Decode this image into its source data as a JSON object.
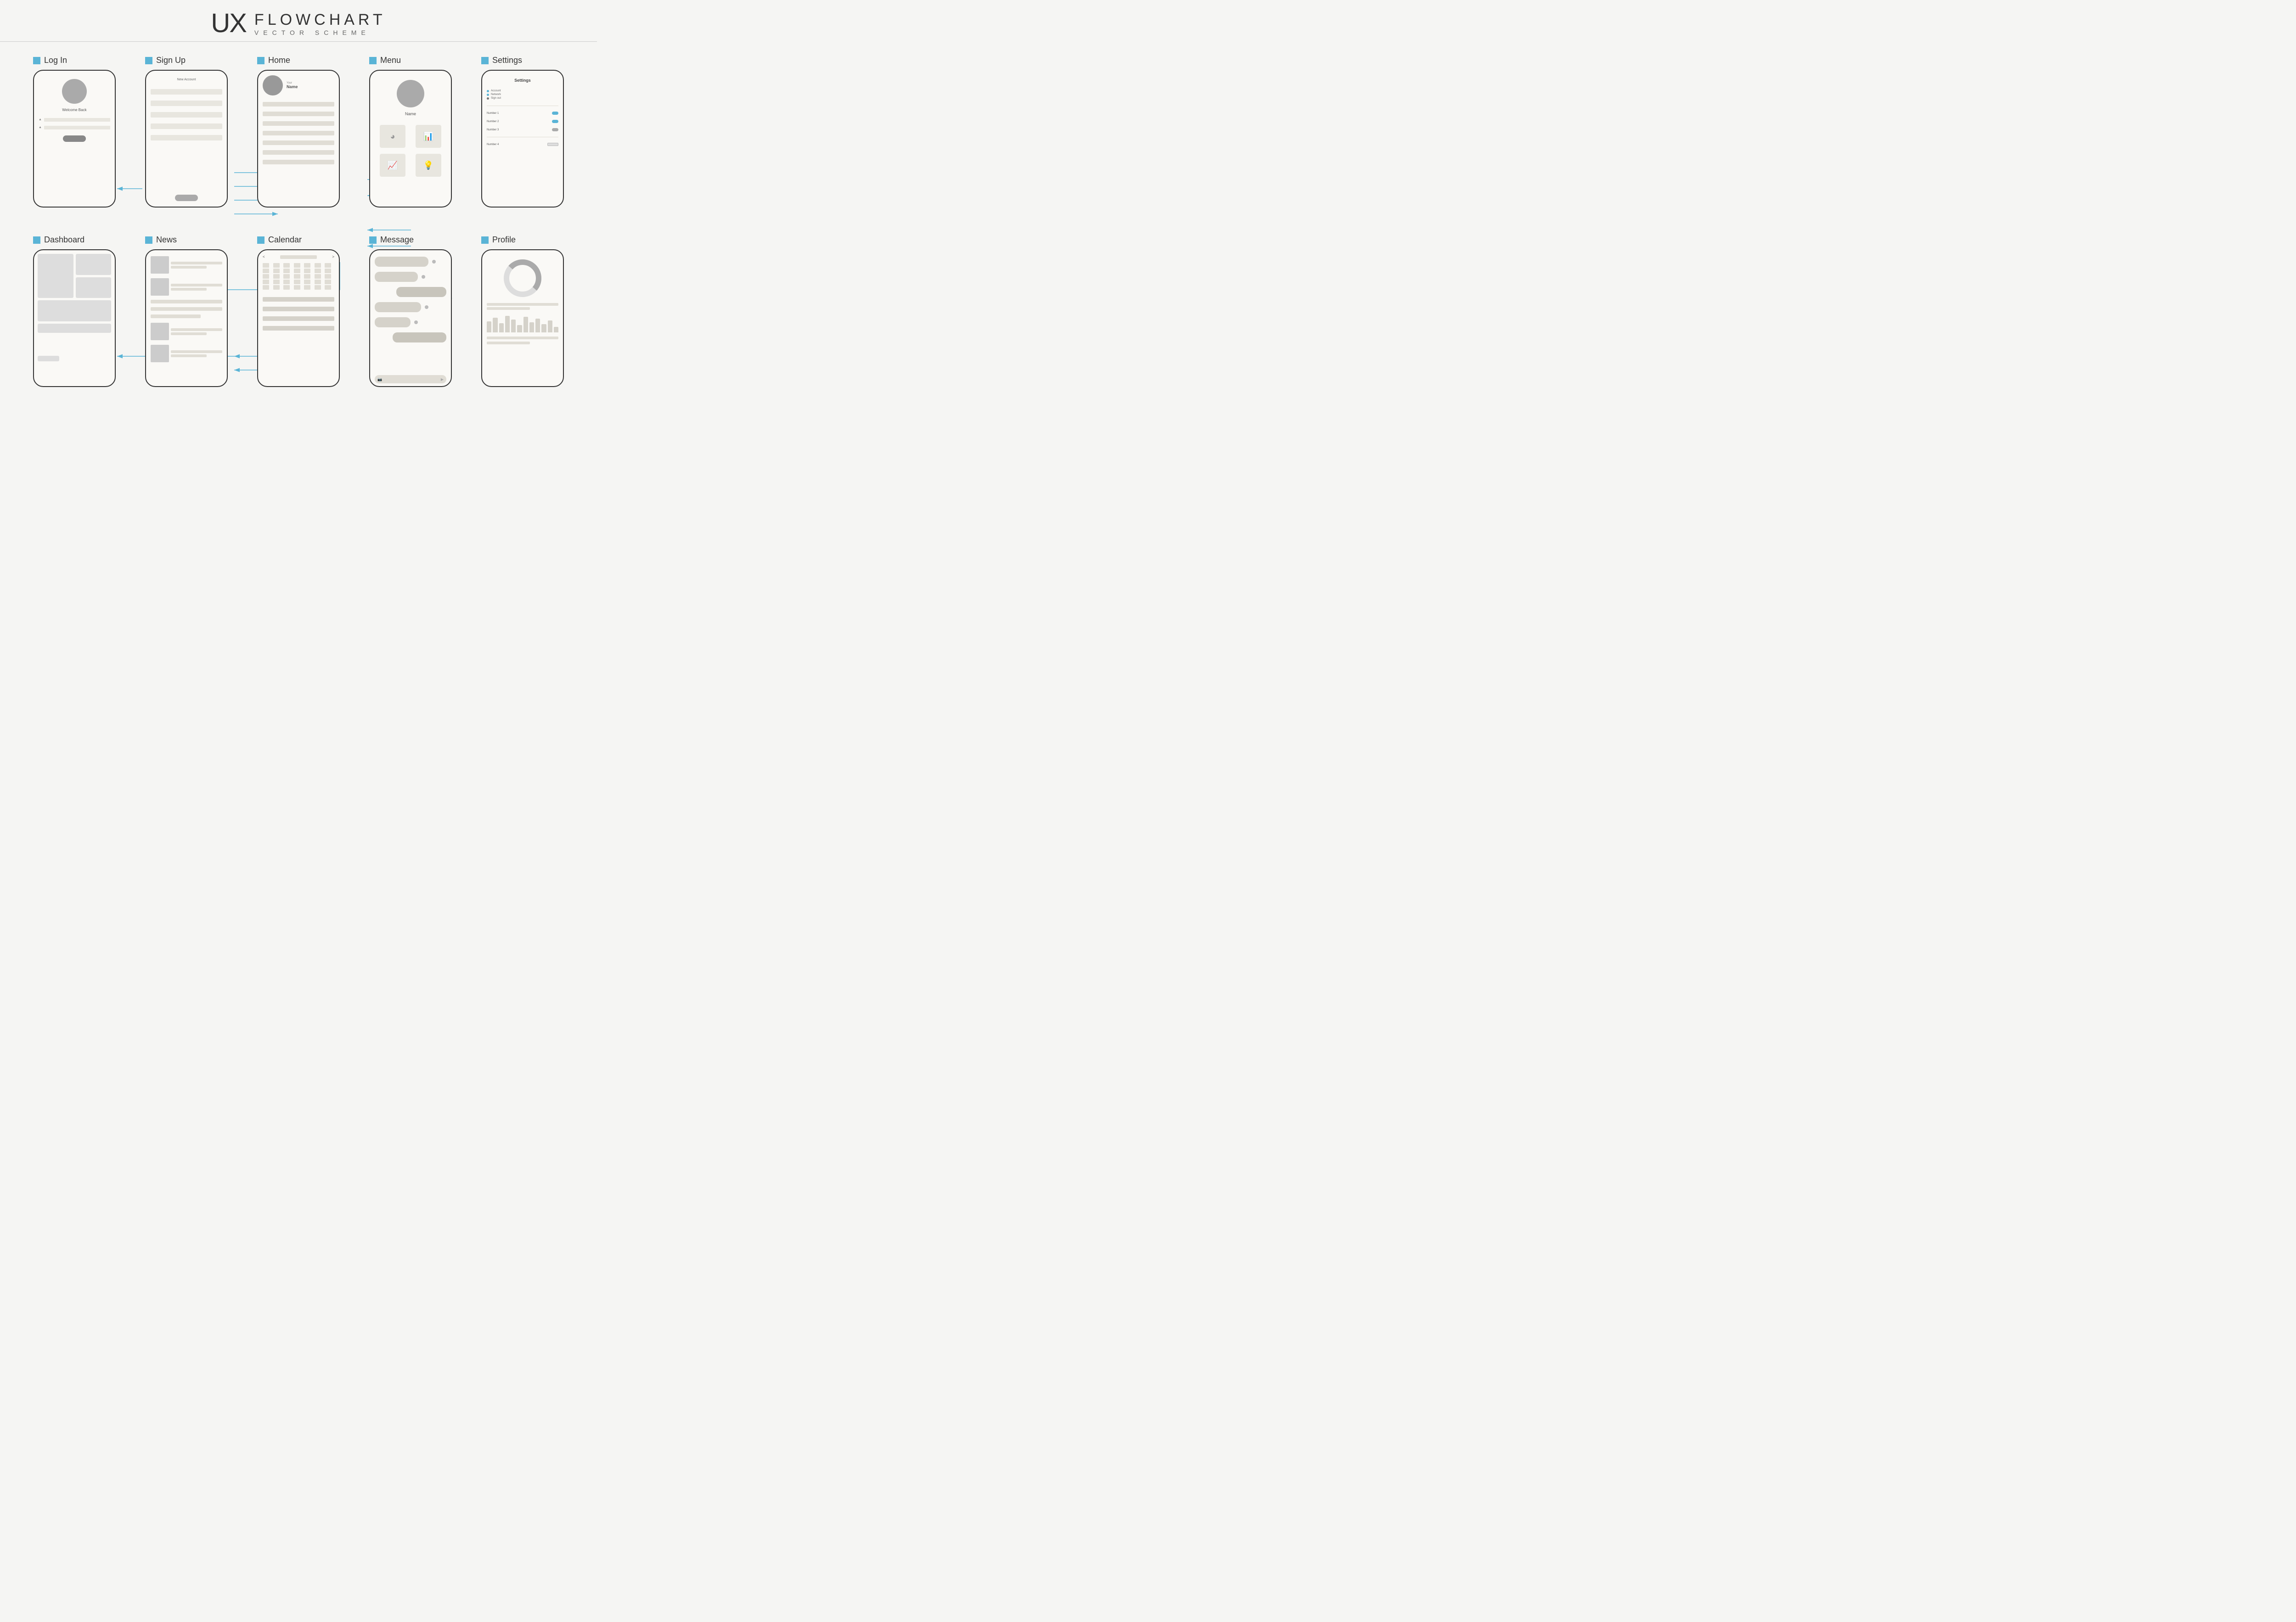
{
  "header": {
    "ux": "UX",
    "flowchart": "FLOWCHART",
    "vector": "VECTOR SCHEME"
  },
  "row1": {
    "sections": [
      {
        "label": "Log In",
        "content": "login",
        "avatar_color": "#aaa",
        "welcome": "Welcome Back"
      },
      {
        "label": "Sign Up",
        "content": "signup",
        "title": "New Account"
      },
      {
        "label": "Home",
        "content": "home",
        "name_small": "Your",
        "name_big": "Name"
      },
      {
        "label": "Menu",
        "content": "menu",
        "name": "Name"
      },
      {
        "label": "Settings",
        "content": "settings",
        "title": "Settings",
        "items": [
          "Account",
          "Network",
          "Sign out"
        ],
        "rows": [
          "Number 1",
          "Number 2",
          "Number 3",
          "Number 4"
        ]
      }
    ]
  },
  "row2": {
    "sections": [
      {
        "label": "Dashboard",
        "content": "dashboard"
      },
      {
        "label": "News",
        "content": "news"
      },
      {
        "label": "Calendar",
        "content": "calendar",
        "prev": "<",
        "next": ">"
      },
      {
        "label": "Message",
        "content": "message"
      },
      {
        "label": "Profile",
        "content": "profile"
      }
    ]
  }
}
